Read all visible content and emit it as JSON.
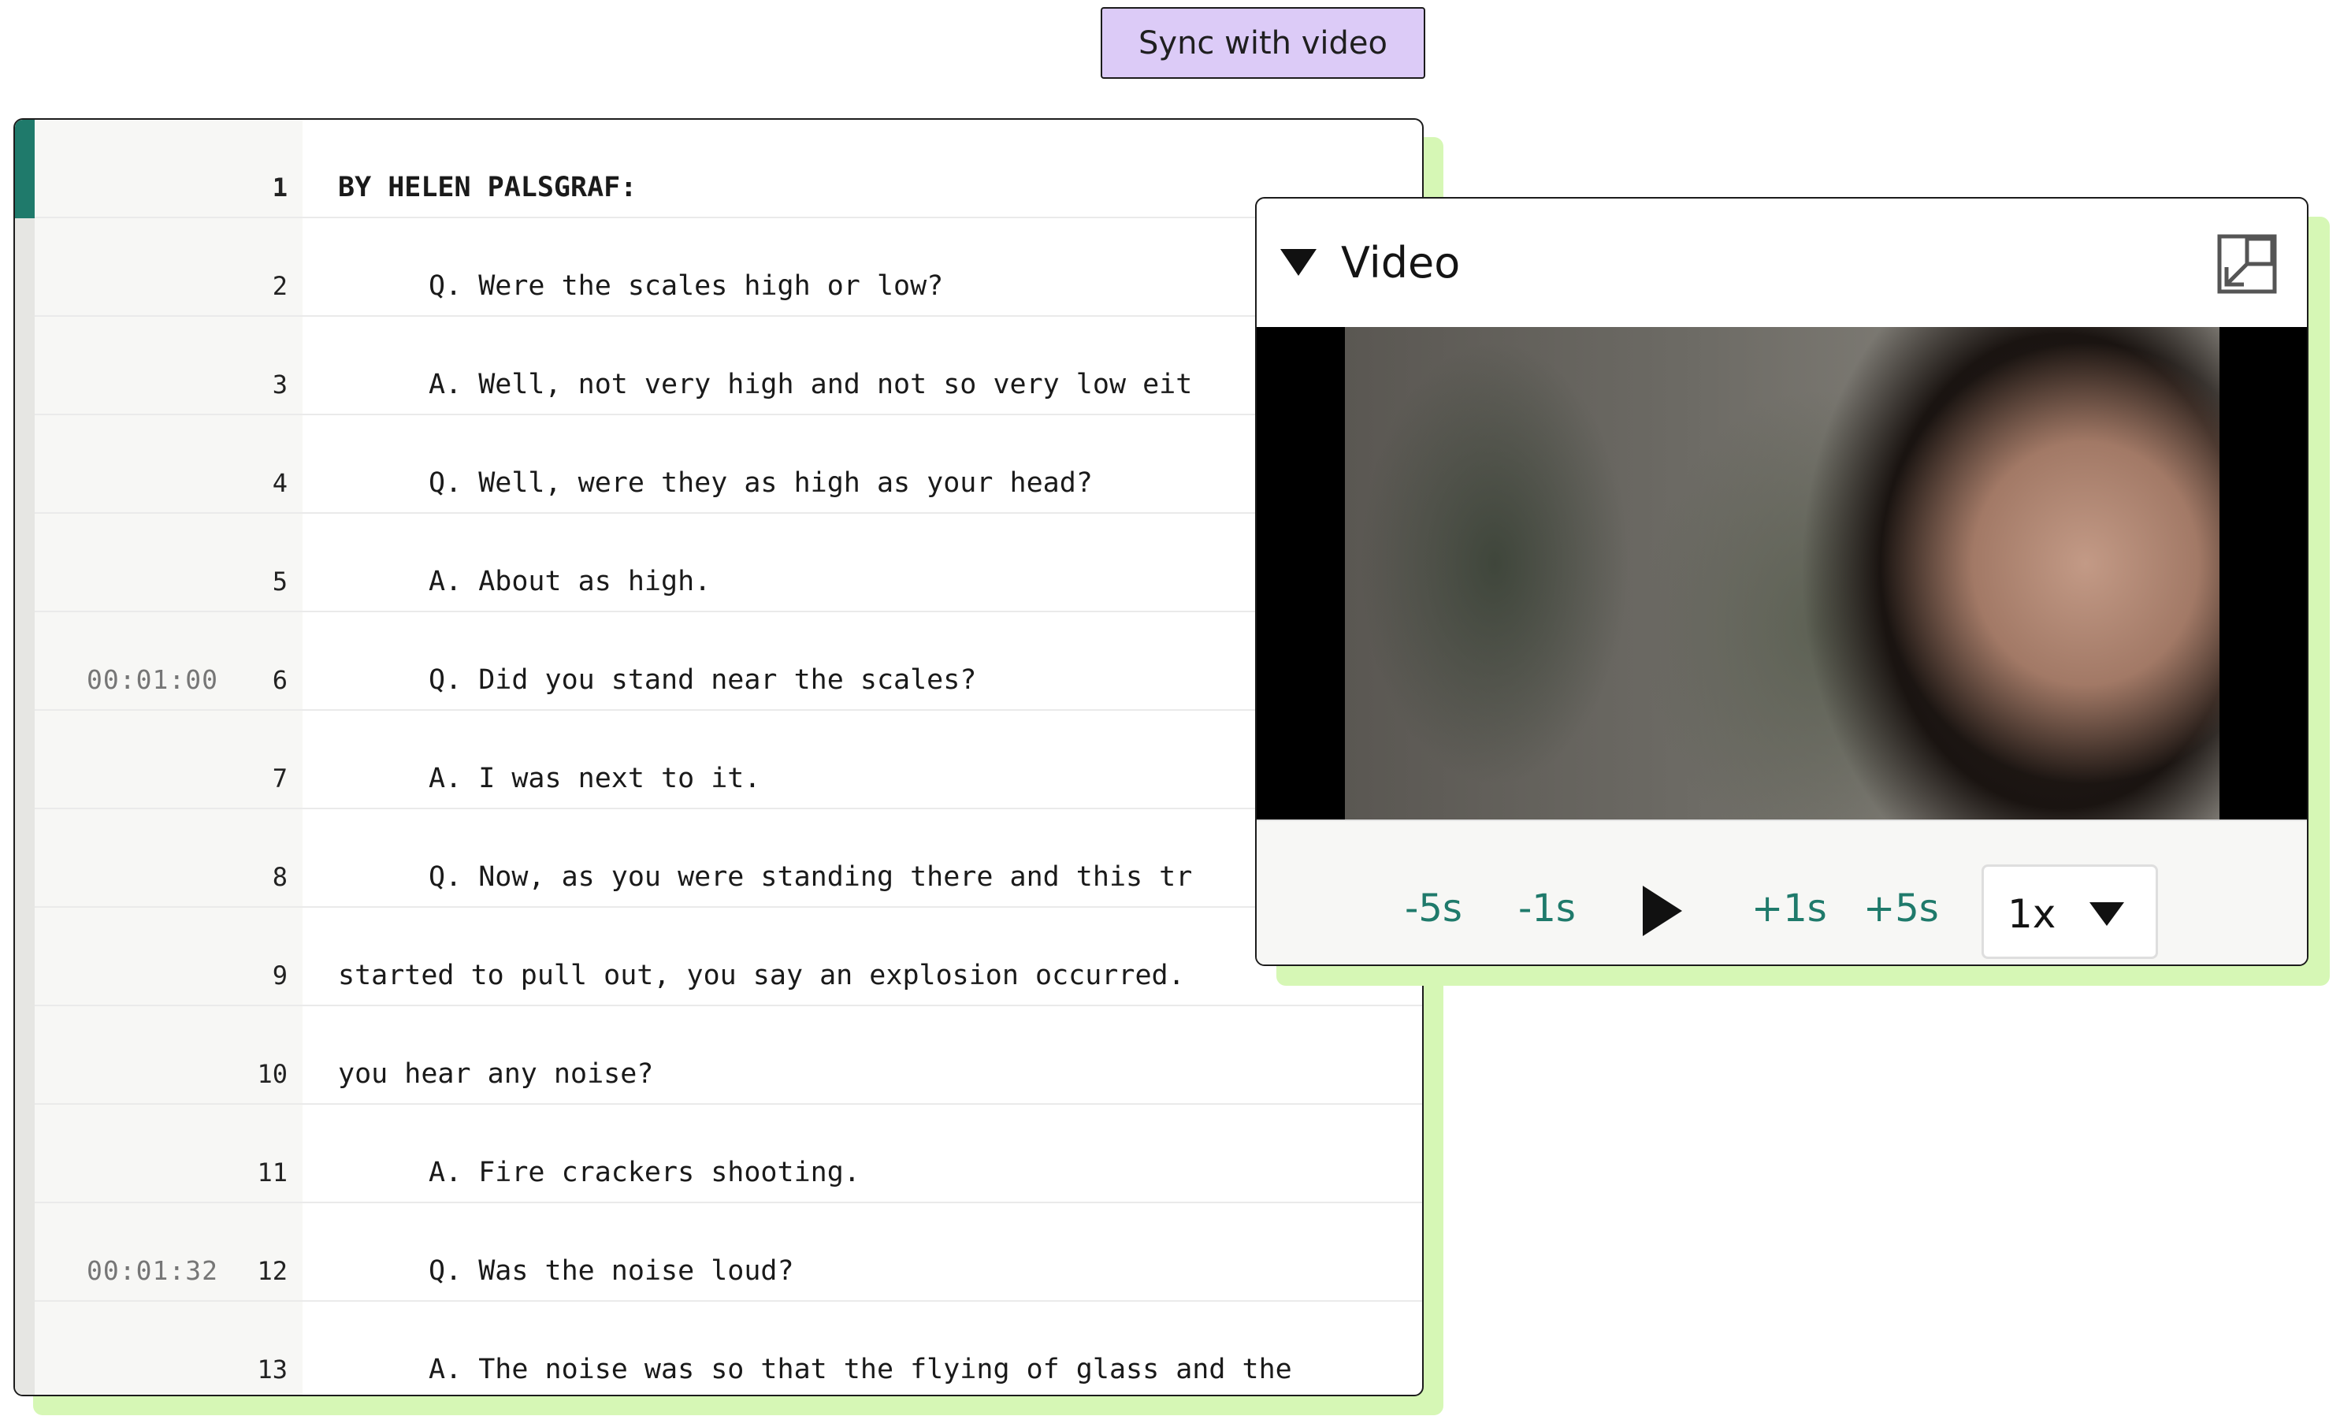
{
  "sync_button": {
    "label": "Sync with video"
  },
  "transcript": {
    "lines": [
      {
        "ln": "1",
        "time": "",
        "text": "BY HELEN PALSGRAF:",
        "indent": false,
        "bold": true
      },
      {
        "ln": "2",
        "time": "",
        "text": "Q. Were the scales high or low?",
        "indent": true,
        "bold": false
      },
      {
        "ln": "3",
        "time": "",
        "text": "A. Well, not very high and not so very low eit",
        "indent": true,
        "bold": false
      },
      {
        "ln": "4",
        "time": "",
        "text": "Q. Well, were they as high as your head?",
        "indent": true,
        "bold": false
      },
      {
        "ln": "5",
        "time": "",
        "text": "A. About as high.",
        "indent": true,
        "bold": false
      },
      {
        "ln": "6",
        "time": "00:01:00",
        "text": "Q. Did you stand near the scales?",
        "indent": true,
        "bold": false
      },
      {
        "ln": "7",
        "time": "",
        "text": "A. I was next to it.",
        "indent": true,
        "bold": false
      },
      {
        "ln": "8",
        "time": "",
        "text": "Q. Now, as you were standing there and this tr",
        "indent": true,
        "bold": false
      },
      {
        "ln": "9",
        "time": "",
        "text": "started to pull out, you say an explosion occurred.",
        "indent": false,
        "bold": false
      },
      {
        "ln": "10",
        "time": "",
        "text": "you hear any noise?",
        "indent": false,
        "bold": false
      },
      {
        "ln": "11",
        "time": "",
        "text": "A. Fire crackers shooting.",
        "indent": true,
        "bold": false
      },
      {
        "ln": "12",
        "time": "00:01:32",
        "text": "Q. Was the noise loud?",
        "indent": true,
        "bold": false
      },
      {
        "ln": "13",
        "time": "",
        "text": "A. The noise was so that the flying of glass and the",
        "indent": true,
        "bold": false
      }
    ]
  },
  "video_panel": {
    "title": "Video",
    "collapse_icon": "triangle-down-icon",
    "popin_icon": "pop-in-icon",
    "controls": {
      "back_5": "-5s",
      "back_1": "-1s",
      "play_icon": "play-icon",
      "fwd_1": "+1s",
      "fwd_5": "+5s",
      "speed": "1x"
    }
  },
  "colors": {
    "accent_teal": "#1f7a6b",
    "sync_button_bg": "#dccbf7",
    "shadow_green": "#d6f7b5"
  }
}
